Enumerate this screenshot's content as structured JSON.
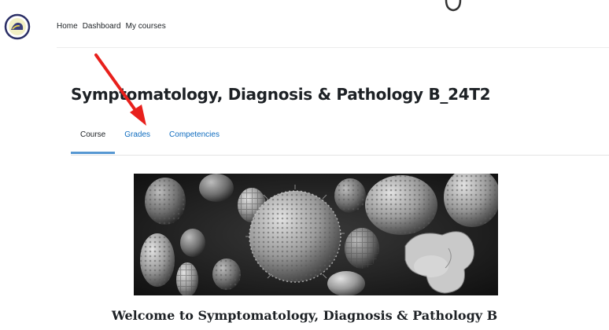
{
  "navbar": {
    "logo_icon": "site-logo-icon",
    "items": [
      {
        "label": "Home"
      },
      {
        "label": "Dashboard"
      },
      {
        "label": "My courses"
      }
    ]
  },
  "course": {
    "title": "Symptomatology, Diagnosis & Pathology B_24T2",
    "tabs": [
      {
        "label": "Course",
        "active": true
      },
      {
        "label": "Grades",
        "active": false
      },
      {
        "label": "Competencies",
        "active": false
      }
    ],
    "banner_icon": "pollen-microscopy-image",
    "welcome": "Welcome to Symptomatology, Diagnosis & Pathology B"
  },
  "annotation": {
    "arrow_icon": "red-arrow-icon",
    "color": "#e8201c"
  },
  "colors": {
    "link": "#0f6cbf",
    "text": "#1d2125",
    "accent_underline": "#0f6cbf"
  }
}
